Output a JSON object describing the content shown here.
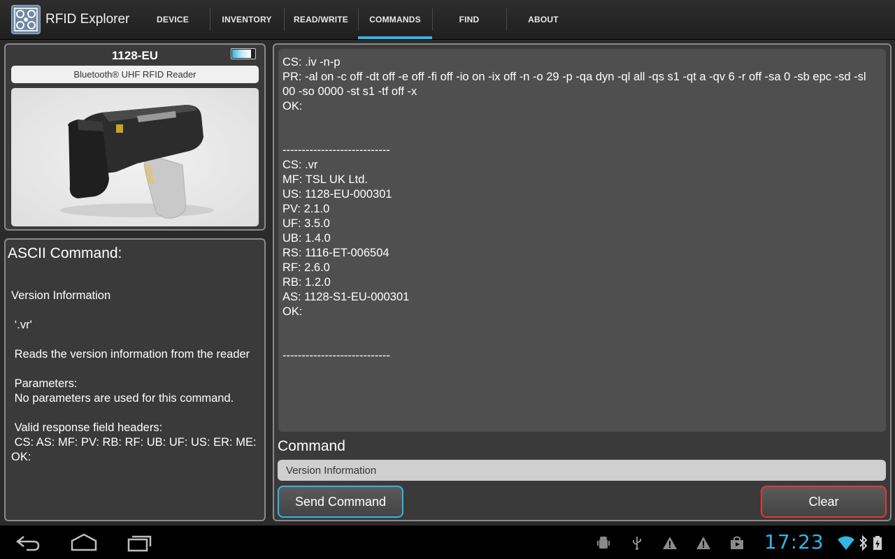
{
  "app": {
    "title": "RFID Explorer",
    "icon": "rfid-app-icon"
  },
  "tabs": [
    {
      "label": "DEVICE",
      "selected": false
    },
    {
      "label": "INVENTORY",
      "selected": false
    },
    {
      "label": "READ/WRITE",
      "selected": false
    },
    {
      "label": "COMMANDS",
      "selected": true
    },
    {
      "label": "FIND",
      "selected": false
    },
    {
      "label": "ABOUT",
      "selected": false
    }
  ],
  "device": {
    "name": "1128-EU",
    "description": "Bluetooth® UHF RFID Reader",
    "battery_level": 0.8
  },
  "ascii_command": {
    "title": "ASCII Command:",
    "info": "Version Information\n\n ‘.vr'\n\n Reads the version information from the reader\n\n Parameters:\n No parameters are used for this command.\n\n Valid response field headers:\n CS: AS: MF: PV: RB: RF: UB: UF: US: ER: ME: OK:"
  },
  "console": {
    "output": "CS: .iv -n-p\nPR: -al on -c off -dt off -e off -fi off -io on -ix off -n -o 29 -p -qa dyn -ql all -qs s1 -qt a -qv 6 -r off -sa 0 -sb epc -sd -sl 00 -so 0000 -st s1 -tf off -x\nOK:\n\n\n----------------------------\nCS: .vr\nMF: TSL UK Ltd.\nUS: 1128-EU-000301\nPV: 2.1.0\nUF: 3.5.0\nUB: 1.4.0\nRS: 1116-ET-006504\nRF: 2.6.0\nRB: 1.2.0\nAS: 1128-S1-EU-000301\nOK:\n\n\n----------------------------"
  },
  "command": {
    "label": "Command",
    "value": "Version Information",
    "send_label": "Send Command",
    "clear_label": "Clear"
  },
  "system_bar": {
    "time": "17:23",
    "accent_color": "#33b5e5"
  }
}
